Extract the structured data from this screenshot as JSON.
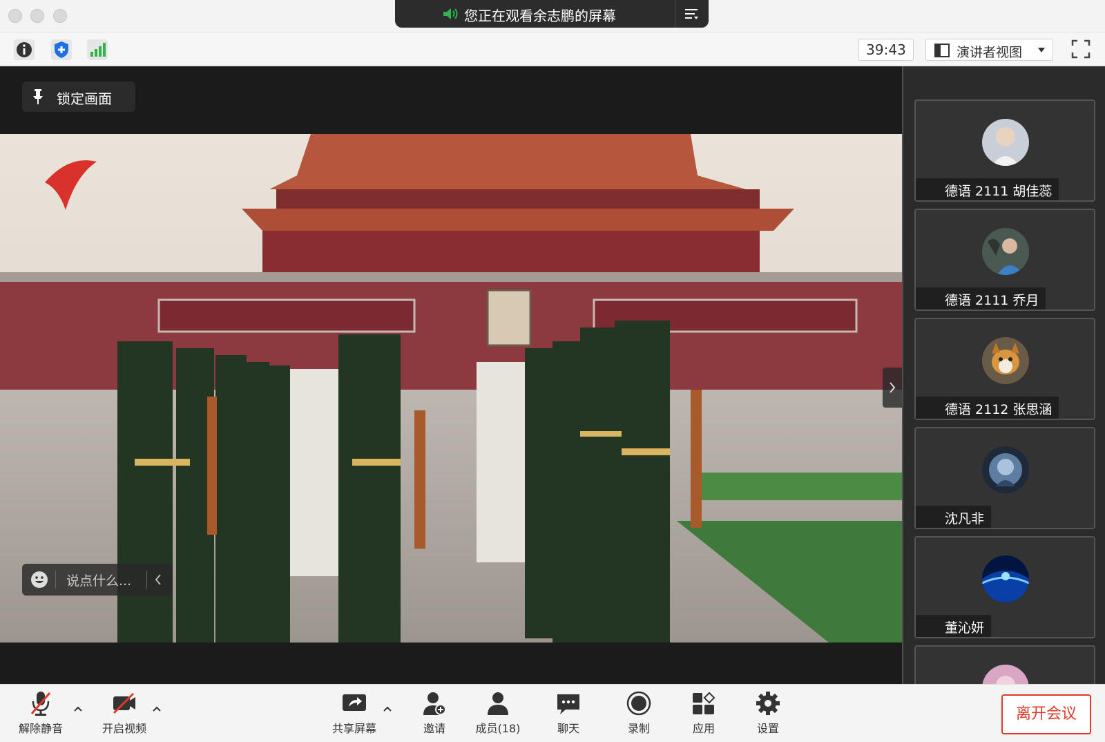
{
  "window": {
    "share_banner_text": "您正在观看余志鹏的屏幕"
  },
  "toolbar": {
    "timer": "39:43",
    "view_mode": "演讲者视图"
  },
  "main": {
    "lock_label": "锁定画面",
    "chat_placeholder": "说点什么..."
  },
  "participants": [
    {
      "name": "德语 2111 胡佳蕊",
      "muted": true
    },
    {
      "name": "德语 2111 乔月",
      "muted": true
    },
    {
      "name": "德语 2112 张思涵",
      "muted": true
    },
    {
      "name": "沈凡非",
      "muted": true
    },
    {
      "name": "董沁妍",
      "muted": true
    }
  ],
  "bottombar": {
    "unmute": "解除静音",
    "start_video": "开启视频",
    "share_screen": "共享屏幕",
    "invite": "邀请",
    "members": "成员(18)",
    "chat": "聊天",
    "record": "录制",
    "apps": "应用",
    "settings": "设置",
    "leave": "离开会议"
  },
  "colors": {
    "leave_red": "#e23a2a",
    "sidebar_bg": "#2b2b2b",
    "shield_blue": "#1f6fe5",
    "signal_green": "#2fb34a"
  }
}
